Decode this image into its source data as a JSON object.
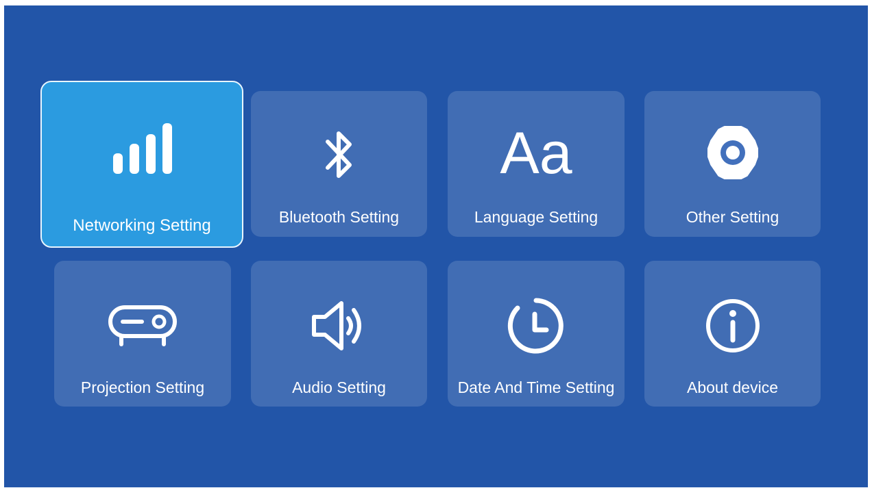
{
  "settings_menu": {
    "tiles": [
      {
        "label": "Networking Setting",
        "icon": "signal-bars-icon",
        "focused": true
      },
      {
        "label": "Bluetooth Setting",
        "icon": "bluetooth-icon",
        "focused": false
      },
      {
        "label": "Language Setting",
        "icon": "language-icon",
        "icon_text": "Aa",
        "focused": false
      },
      {
        "label": "Other Setting",
        "icon": "gear-icon",
        "focused": false
      },
      {
        "label": "Projection Setting",
        "icon": "projector-icon",
        "focused": false
      },
      {
        "label": "Audio Setting",
        "icon": "speaker-icon",
        "focused": false
      },
      {
        "label": "Date And Time Setting",
        "icon": "clock-icon",
        "focused": false
      },
      {
        "label": "About device",
        "icon": "info-icon",
        "focused": false
      }
    ]
  },
  "colors": {
    "background": "#2255a8",
    "tile": "rgba(255,255,255,0.14)",
    "focused_tile": "#2b9be0",
    "text": "#ffffff"
  }
}
